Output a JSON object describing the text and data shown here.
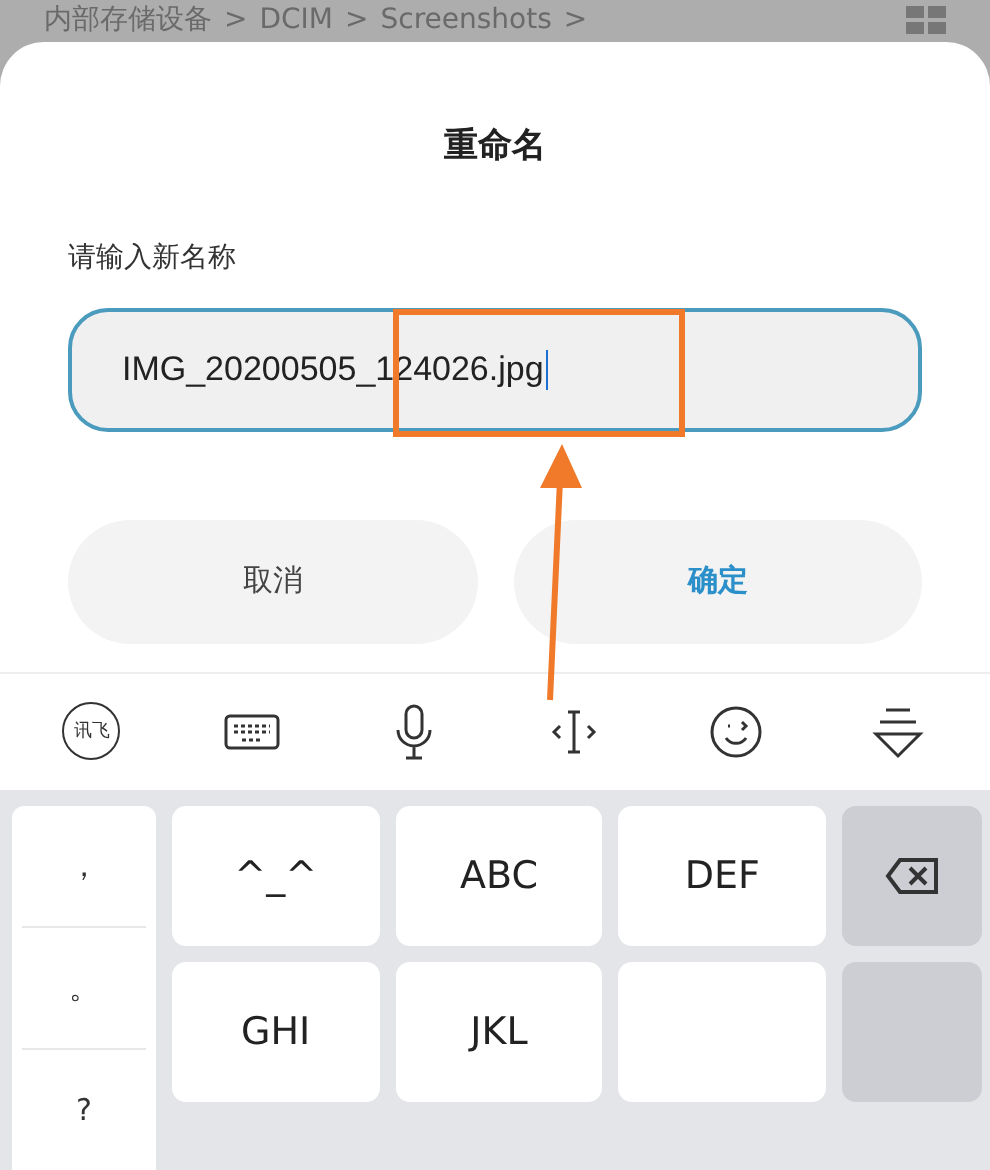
{
  "breadcrumb": {
    "parts": [
      "内部存储设备",
      "DCIM",
      "Screenshots"
    ],
    "separator": ">"
  },
  "dialog": {
    "title": "重命名",
    "label": "请输入新名称",
    "field": {
      "value": "IMG_20200505_124026.jpg",
      "focused": true
    },
    "buttons": [
      {
        "label": "取消",
        "kind": "cancel"
      },
      {
        "label": "确定",
        "kind": "confirm"
      }
    ]
  },
  "annotation": {
    "kind": "highlight-arrow"
  },
  "toolbar": [
    {
      "kind": "logo",
      "label": "讯飞"
    },
    {
      "kind": "keyboard"
    },
    {
      "kind": "mic"
    },
    {
      "kind": "cursor"
    },
    {
      "kind": "emoji"
    },
    {
      "kind": "hide"
    }
  ],
  "symbols": [
    "，",
    "。",
    "?"
  ],
  "keys": [
    {
      "label": "^_^",
      "kind": "char"
    },
    {
      "label": "ABC",
      "kind": "char"
    },
    {
      "label": "DEF",
      "kind": "char"
    },
    {
      "kind": "delete"
    },
    {
      "label": "GHI",
      "kind": "char"
    },
    {
      "label": "JKL",
      "kind": "char"
    },
    {
      "kind": "blank"
    },
    {
      "kind": "gray"
    }
  ]
}
